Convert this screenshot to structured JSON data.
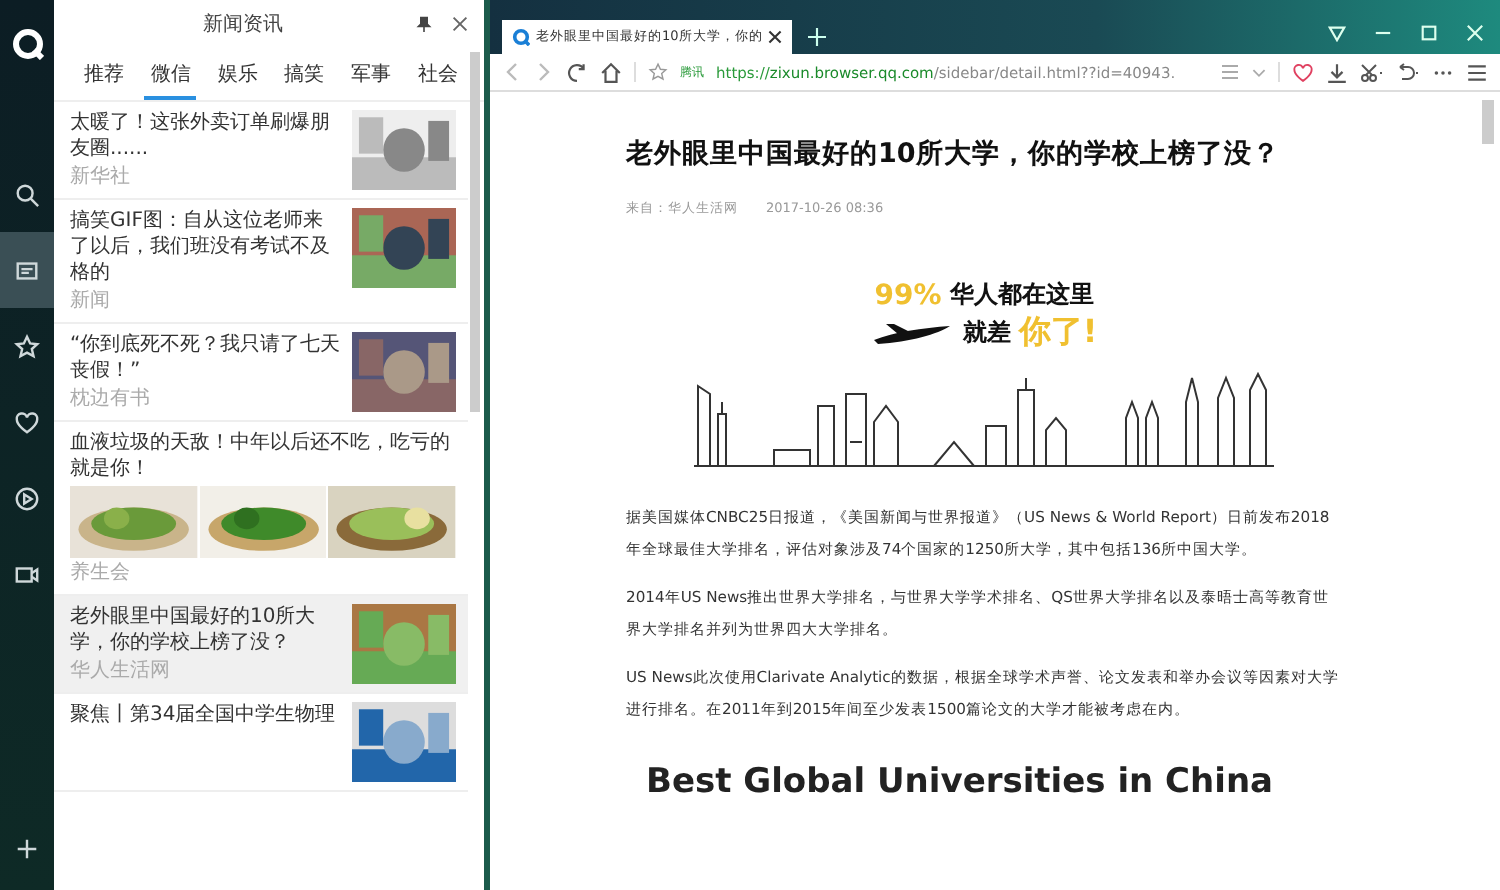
{
  "rail": {
    "items": [
      {
        "kind": "search",
        "selected": false
      },
      {
        "kind": "news",
        "selected": true
      },
      {
        "kind": "star",
        "selected": false
      },
      {
        "kind": "heart",
        "selected": false
      },
      {
        "kind": "play",
        "selected": false
      },
      {
        "kind": "video",
        "selected": false
      }
    ]
  },
  "sidebar": {
    "title": "新闻资讯",
    "tabs": [
      {
        "label": "推荐",
        "selected": false
      },
      {
        "label": "微信",
        "selected": true
      },
      {
        "label": "娱乐",
        "selected": false
      },
      {
        "label": "搞笑",
        "selected": false
      },
      {
        "label": "军事",
        "selected": false
      },
      {
        "label": "社会",
        "selected": false
      }
    ],
    "items": [
      {
        "kind": "thumb",
        "title": "太暖了！这张外卖订单刷爆朋友圈......",
        "source": "新华社",
        "selected": false
      },
      {
        "kind": "thumb",
        "title": "搞笑GIF图：自从这位老师来了以后，我们班没有考试不及格的",
        "source": "新闻",
        "selected": false
      },
      {
        "kind": "thumb",
        "title": "“你到底死不死？我只请了七天丧假！”",
        "source": "枕边有书",
        "selected": false
      },
      {
        "kind": "triple",
        "title": "血液垃圾的天敌！中年以后还不吃，吃亏的就是你！",
        "source": "养生会",
        "selected": false
      },
      {
        "kind": "thumb",
        "title": "老外眼里中国最好的10所大学，你的学校上榜了没？",
        "source": "华人生活网",
        "selected": true
      },
      {
        "kind": "thumb",
        "title": "聚焦丨第34届全国中学生物理",
        "selected": false
      }
    ]
  },
  "browser": {
    "tab": {
      "title": "老外眼里中国最好的10所大学，你的"
    },
    "address_bar": {
      "badge": "腾讯",
      "scheme": "https://",
      "host": "zixun.browser.qq.com",
      "path": "/sidebar/detail.html??id=40943."
    }
  },
  "article": {
    "title": "老外眼里中国最好的10所大学，你的学校上榜了没？",
    "source": "来自：华人生活网",
    "date": "2017-10-26 08:36",
    "banner": {
      "line_1": [
        "99%",
        "华人都在这里"
      ],
      "line_2": [
        "就差",
        "你了!"
      ]
    },
    "paragraphs": [
      "据美国媒体CNBC25日报道，《美国新闻与世界报道》（US News & World Report）日前发布2018年全球最佳大学排名，评估对象涉及74个国家的1250所大学，其中包括136所中国大学。",
      "2014年US News推出世界大学排名，与世界大学学术排名、QS世界大学排名以及泰晤士高等教育世界大学排名并列为世界四大大学排名。",
      "US News此次使用Clarivate Analytic的数据，根据全球学术声誉、论文发表和举办会议等因素对大学进行排名。在2011年到2015年间至少发表1500篇论文的大学才能被考虑在内。"
    ],
    "heading": "Best Global Universities in China"
  }
}
